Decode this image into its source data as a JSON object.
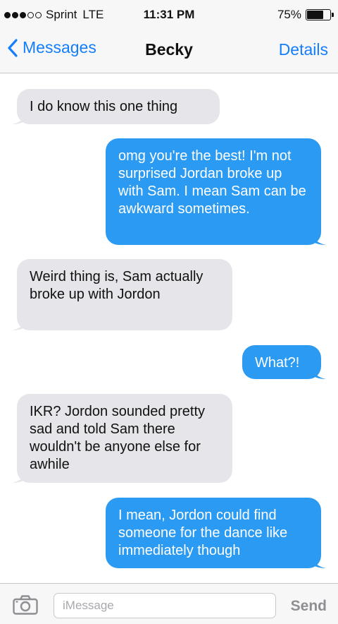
{
  "status_bar": {
    "carrier": "Sprint",
    "network": "LTE",
    "time": "11:31 PM",
    "battery_text": "75%",
    "battery_level": 0.75,
    "signal_filled": 3,
    "signal_total": 5
  },
  "nav": {
    "back_label": "Messages",
    "title": "Becky",
    "details_label": "Details"
  },
  "thread": {
    "messages": [
      {
        "from": "received",
        "text": "I do know this one thing"
      },
      {
        "from": "sent",
        "text": "omg you're the best! I'm not surprised Jordan broke up with Sam. I mean Sam can be awkward sometimes."
      },
      {
        "from": "received",
        "text": "Weird thing is, Sam actually broke up with Jordon"
      },
      {
        "from": "sent",
        "text": "What?!"
      },
      {
        "from": "received",
        "text": "IKR? Jordon sounded pretty sad and told Sam there wouldn't be anyone else for awhile"
      },
      {
        "from": "sent",
        "text": "I mean, Jordon could find someone for the dance like immediately though"
      }
    ]
  },
  "input_bar": {
    "placeholder": "iMessage",
    "send_label": "Send",
    "camera_icon": "camera-icon"
  },
  "colors": {
    "accent": "#147efb",
    "sent_bubble": "#2b9af3",
    "received_bubble": "#e5e5ea"
  }
}
